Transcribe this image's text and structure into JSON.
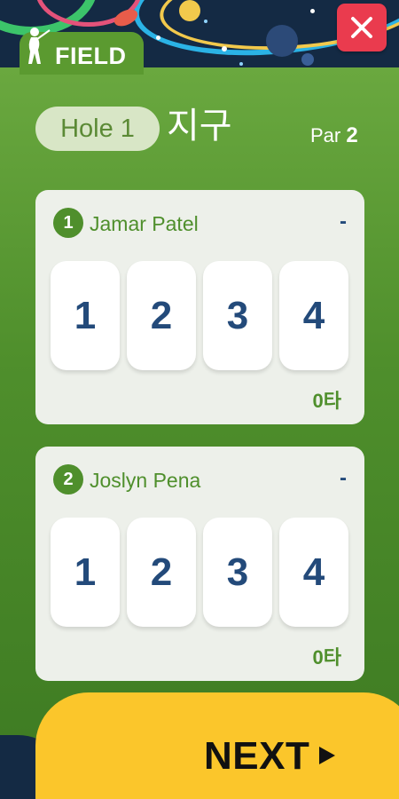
{
  "header": {
    "field_label": "FIELD",
    "close_icon": "close-icon",
    "golfer_icon": "golfer-icon"
  },
  "hole": {
    "label": "Hole 1",
    "name": "지구",
    "par_label": "Par",
    "par_value": "2"
  },
  "players": [
    {
      "number": "1",
      "name": "Jamar Patel",
      "score": "-",
      "options": [
        "1",
        "2",
        "3",
        "4"
      ],
      "strokes": "0타"
    },
    {
      "number": "2",
      "name": "Joslyn Pena",
      "score": "-",
      "options": [
        "1",
        "2",
        "3",
        "4"
      ],
      "strokes": "0타"
    }
  ],
  "footer": {
    "next_label": "NEXT",
    "arrow_icon": "play-arrow-icon"
  },
  "colors": {
    "accent_green": "#4f8f2c",
    "score_blue": "#234a7a",
    "close_red": "#ea3b4e",
    "next_yellow": "#fbc62b"
  }
}
